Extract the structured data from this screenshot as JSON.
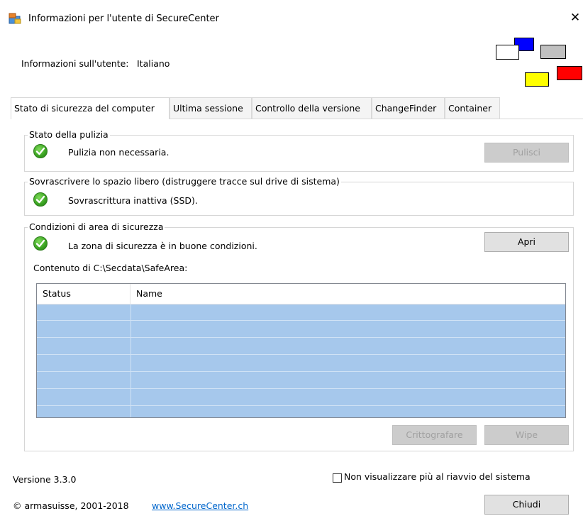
{
  "window": {
    "title": "Informazioni per l'utente di SecureCenter",
    "close_glyph": "✕"
  },
  "user_info": {
    "label": "Informazioni sull'utente:",
    "value": "Italiano"
  },
  "tabs": [
    {
      "label": "Stato di sicurezza del computer",
      "active": true
    },
    {
      "label": "Ultima sessione",
      "active": false
    },
    {
      "label": "Controllo della versione",
      "active": false
    },
    {
      "label": "ChangeFinder",
      "active": false
    },
    {
      "label": "Container",
      "active": false
    }
  ],
  "groups": {
    "cleanup": {
      "title": "Stato della pulizia",
      "status": "Pulizia non necessaria.",
      "button": "Pulisci"
    },
    "overwrite": {
      "title": "Sovrascrivere lo spazio libero (distruggere tracce sul drive di sistema)",
      "status": "Sovrascrittura inattiva (SSD)."
    },
    "safe_area": {
      "title": "Condizioni di area di sicurezza",
      "status": "La zona di sicurezza è in buone condizioni.",
      "open_button": "Apri",
      "contents_label": "Contenuto di C:\\Secdata\\SafeArea:",
      "columns": [
        "Status",
        "Name"
      ],
      "encrypt_button": "Crittografare",
      "wipe_button": "Wipe"
    }
  },
  "footer": {
    "version": "Versione  3.3.0",
    "dont_show_label": "Non visualizzare più al riavvio del sistema",
    "copyright": "© armasuisse, 2001-2018",
    "website": "www.SecureCenter.ch",
    "close_button": "Chiudi"
  },
  "colors": {
    "selection": "#a6c8ec",
    "link": "#0066cc",
    "flag_blue": "#0000ff",
    "flag_white": "#ffffff",
    "flag_gray": "#c0c0c0",
    "flag_yellow": "#ffff00",
    "flag_red": "#ff0000"
  }
}
